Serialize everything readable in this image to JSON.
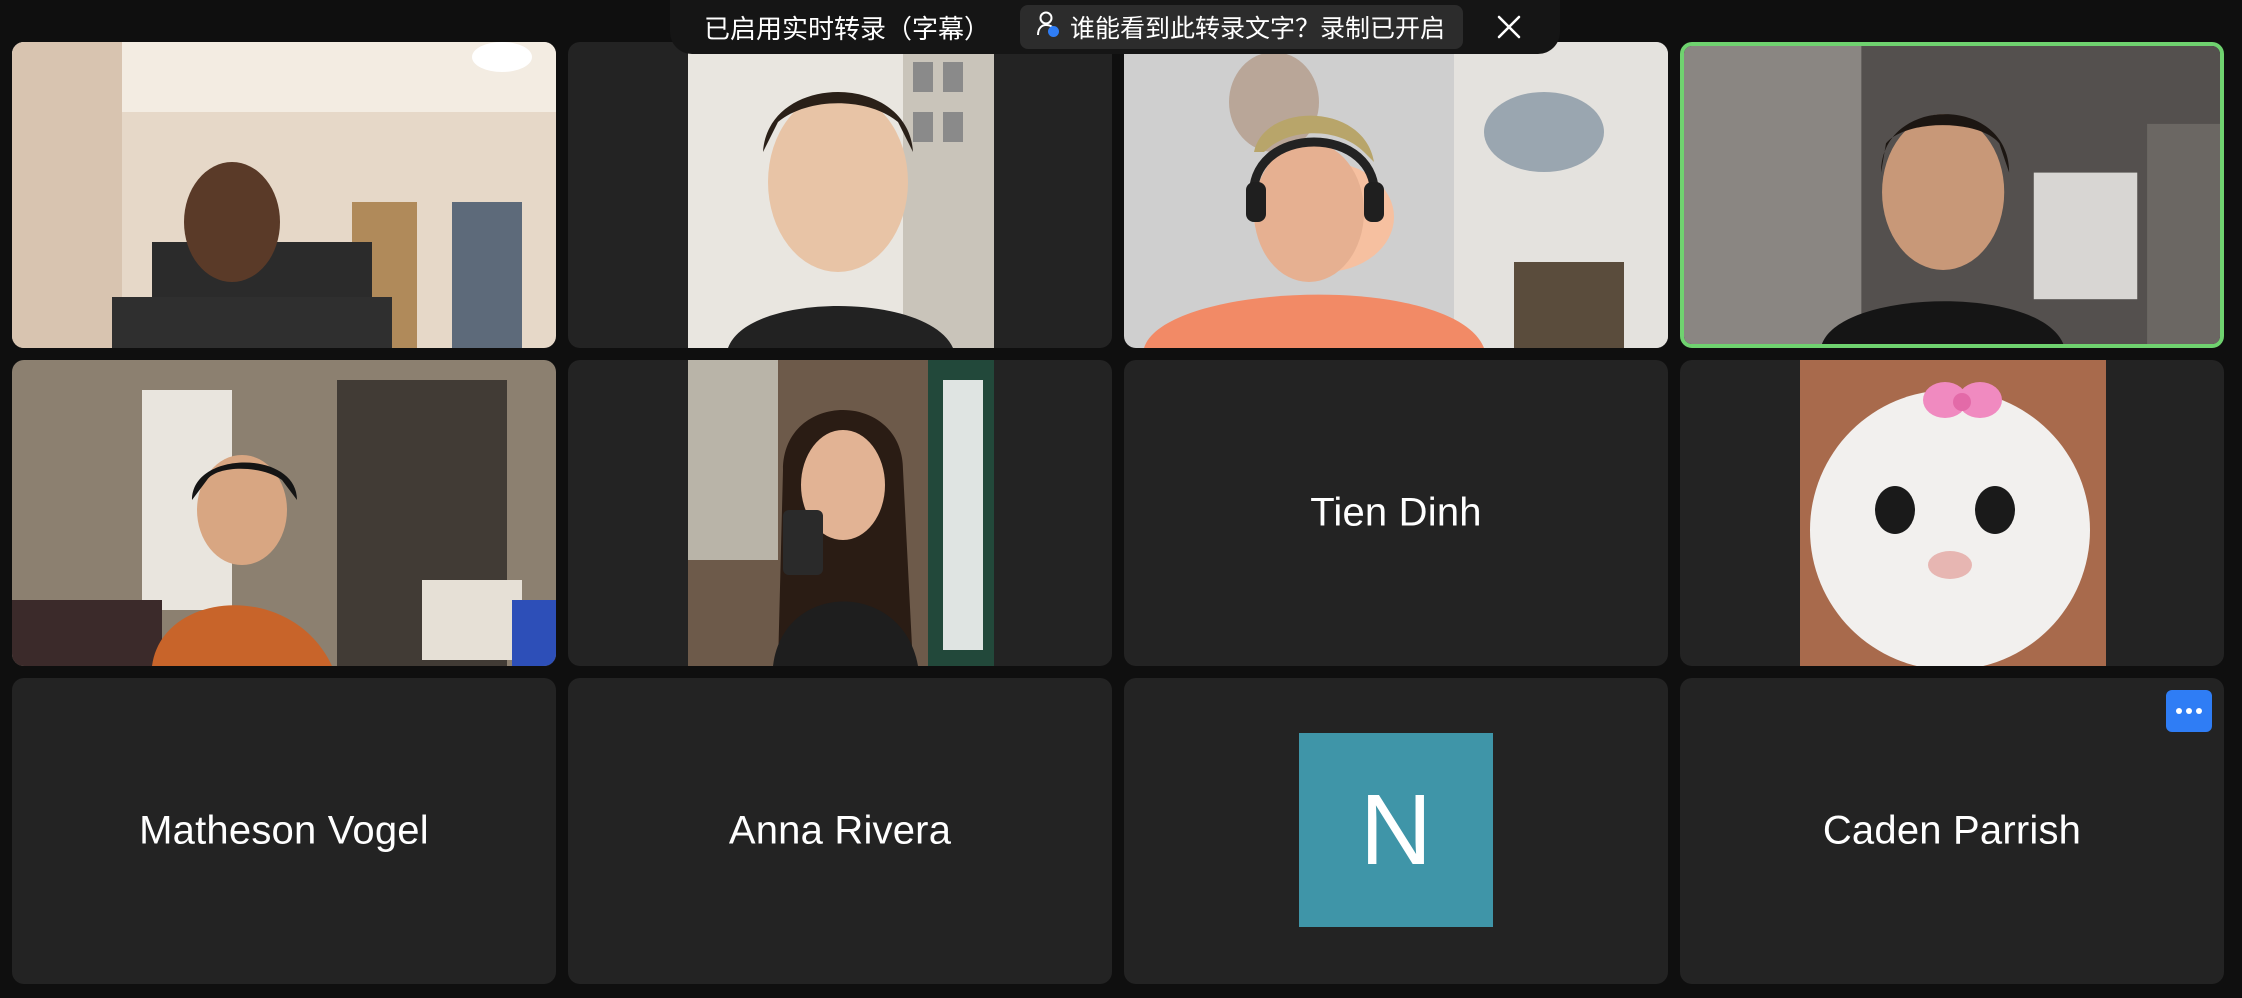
{
  "caption_banner": {
    "status_text": "已启用实时转录（字幕）",
    "question_text": "谁能看到此转录文字？录制已开启",
    "person_icon": "person-with-dot-icon",
    "close_icon": "close-icon"
  },
  "participants": [
    {
      "tile": "video",
      "description": "man with glasses"
    },
    {
      "tile": "video",
      "description": "young man"
    },
    {
      "tile": "video",
      "description": "young man with headphones"
    },
    {
      "tile": "video",
      "active_speaker": true,
      "description": "woman speaking"
    },
    {
      "tile": "video",
      "description": "young man at desk"
    },
    {
      "tile": "video",
      "description": "woman holding coffee"
    },
    {
      "tile": "name",
      "name": "Tien Dinh"
    },
    {
      "tile": "image",
      "description": "cat meme profile picture"
    },
    {
      "tile": "name",
      "name": "Matheson Vogel"
    },
    {
      "tile": "name",
      "name": "Anna Rivera"
    },
    {
      "tile": "avatar",
      "initial": "N"
    },
    {
      "tile": "name",
      "name": "Caden Parrish",
      "more_icon": "more-options-icon"
    }
  ],
  "colors": {
    "active_speaker_border": "#6fd26f",
    "avatar_background": "#3f95a8",
    "more_button": "#2f7df5",
    "tile_background": "#232323"
  }
}
